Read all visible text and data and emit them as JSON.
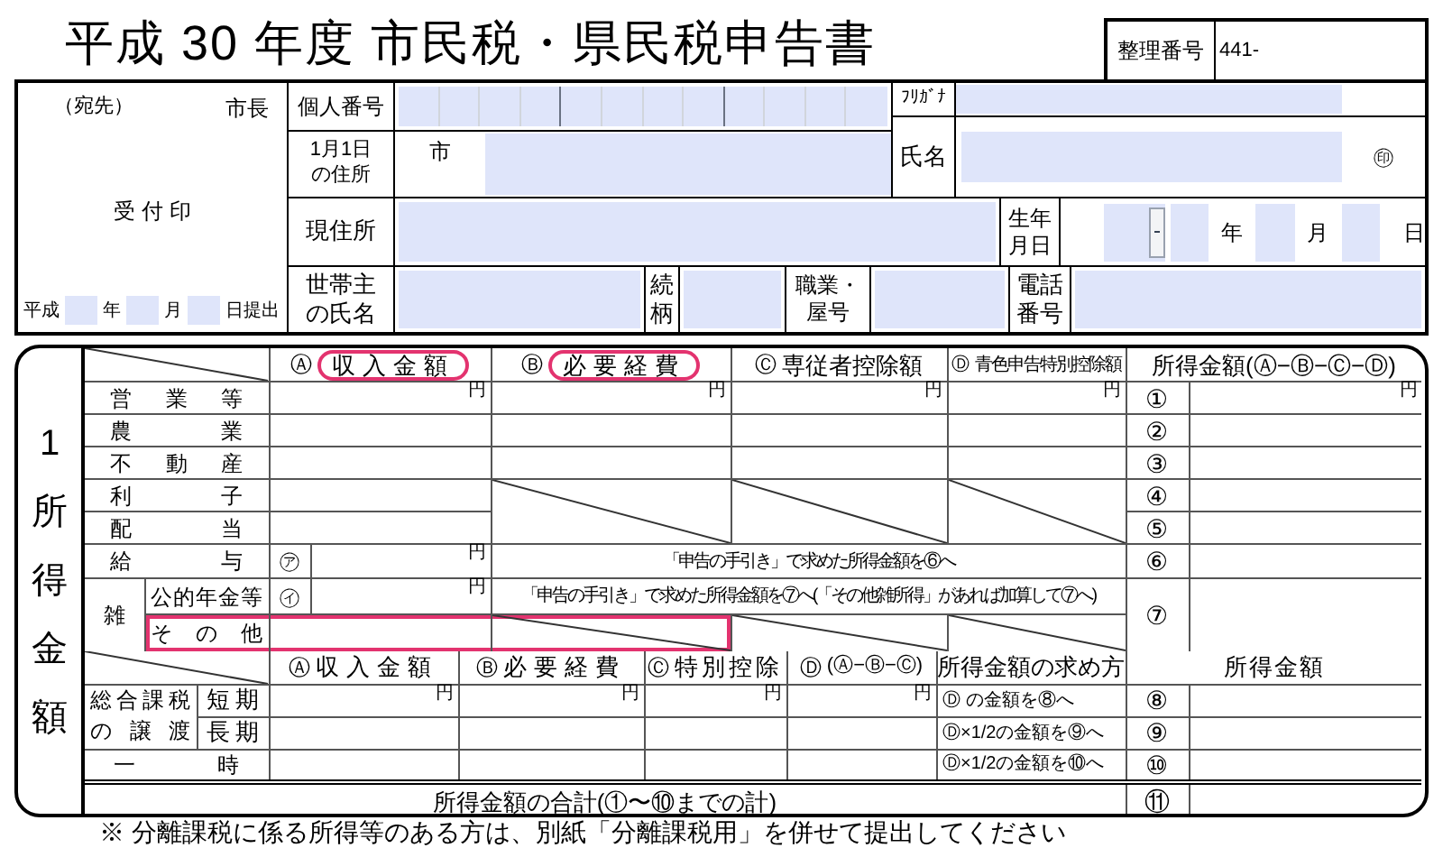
{
  "title": "平成 30 年度 市民税・県民税申告書",
  "reference": {
    "label": "整理番号",
    "value": "441-"
  },
  "office": {
    "addressee": "（宛先）",
    "mayor": "市長",
    "stamp": "受 付 印",
    "era": "平成",
    "year_unit": "年",
    "month_unit": "月",
    "day_suffix": "日提出"
  },
  "taxpayer": {
    "individual_number": "個人番号",
    "furigana": "ﾌﾘｶﾞﾅ",
    "jan1_address": "1月1日の住所",
    "city_prefix": "市",
    "name": "氏名",
    "seal": "㊞",
    "current_address": "現住所",
    "birth_date": "生年月日",
    "birth_year_unit": "年",
    "birth_month_unit": "月",
    "birth_day_unit": "日",
    "householder": "世帯主の氏名",
    "relationship": "続柄",
    "occupation": "職業・屋号",
    "phone": "電話番号"
  },
  "income": {
    "section_label": "1所得金額",
    "columns": [
      {
        "marker": "Ⓐ",
        "label": "収入金額",
        "highlighted": true
      },
      {
        "marker": "Ⓑ",
        "label": "必要経費",
        "highlighted": true
      },
      {
        "marker": "Ⓒ",
        "label": "専従者控除額",
        "highlighted": false
      },
      {
        "marker": "Ⓓ",
        "label": "青色申告特別控除額",
        "highlighted": false
      },
      {
        "label": "所得金額(Ⓐ−Ⓑ−Ⓒ−Ⓓ)",
        "highlighted": false
      }
    ],
    "rows": [
      {
        "kind": "standard",
        "label": "営業等",
        "number": "①",
        "units": [
          "円",
          "円",
          "円",
          "円",
          "円"
        ]
      },
      {
        "kind": "standard",
        "label": "農業",
        "number": "②"
      },
      {
        "kind": "standard",
        "label": "不動産",
        "number": "③"
      },
      {
        "kind": "income_only",
        "label": "利子",
        "number": "④"
      },
      {
        "kind": "income_only",
        "label": "配当",
        "number": "⑤"
      },
      {
        "kind": "guided",
        "label": "給与",
        "marker": "㋐",
        "note": "「申告の手引き」で求めた所得金額を⑥へ",
        "number": "⑥",
        "units": [
          "円"
        ]
      }
    ],
    "misc": {
      "label": "雑",
      "number": "⑦",
      "rows": [
        {
          "kind": "guided",
          "label": "公的年金等",
          "marker": "㋑",
          "note": "「申告の手引き」で求めた所得金額を⑦へ(「その他雑所得」があれば加算して⑦へ)",
          "units": [
            "円"
          ],
          "highlighted": false
        },
        {
          "kind": "income_only",
          "label": "その他",
          "highlighted": true
        }
      ]
    }
  },
  "transfer": {
    "columns": [
      {
        "marker": "Ⓐ",
        "label": "収入金額",
        "highlighted": false
      },
      {
        "marker": "Ⓑ",
        "label": "必要経費",
        "highlighted": false
      },
      {
        "marker": "Ⓒ",
        "label": "特別控除",
        "highlighted": false
      },
      {
        "marker": "Ⓓ",
        "label": "(Ⓐ−Ⓑ−Ⓒ)",
        "highlighted": false
      },
      {
        "label": "所得金額の求め方",
        "highlighted": false
      },
      {
        "label": "所得金額",
        "highlighted": false
      }
    ],
    "group": {
      "label": "総合課税の譲渡",
      "rows": [
        {
          "label": "短期",
          "method": "Ⓓ の金額を⑧へ",
          "number": "⑧",
          "units": [
            "円",
            "円",
            "円",
            "円"
          ]
        },
        {
          "label": "長期",
          "method": "Ⓓ×1/2の金額を⑨へ",
          "number": "⑨"
        }
      ]
    },
    "lump": {
      "label": "一時",
      "method": "Ⓓ×1/2の金額を⑩へ",
      "number": "⑩"
    },
    "total": {
      "label": "所得金額の合計(①〜⑩までの計)",
      "number": "⑪"
    }
  },
  "footnote": "※ 分離課税に係る所得等のある方は、別紙「分離課税用」を併せて提出してください"
}
